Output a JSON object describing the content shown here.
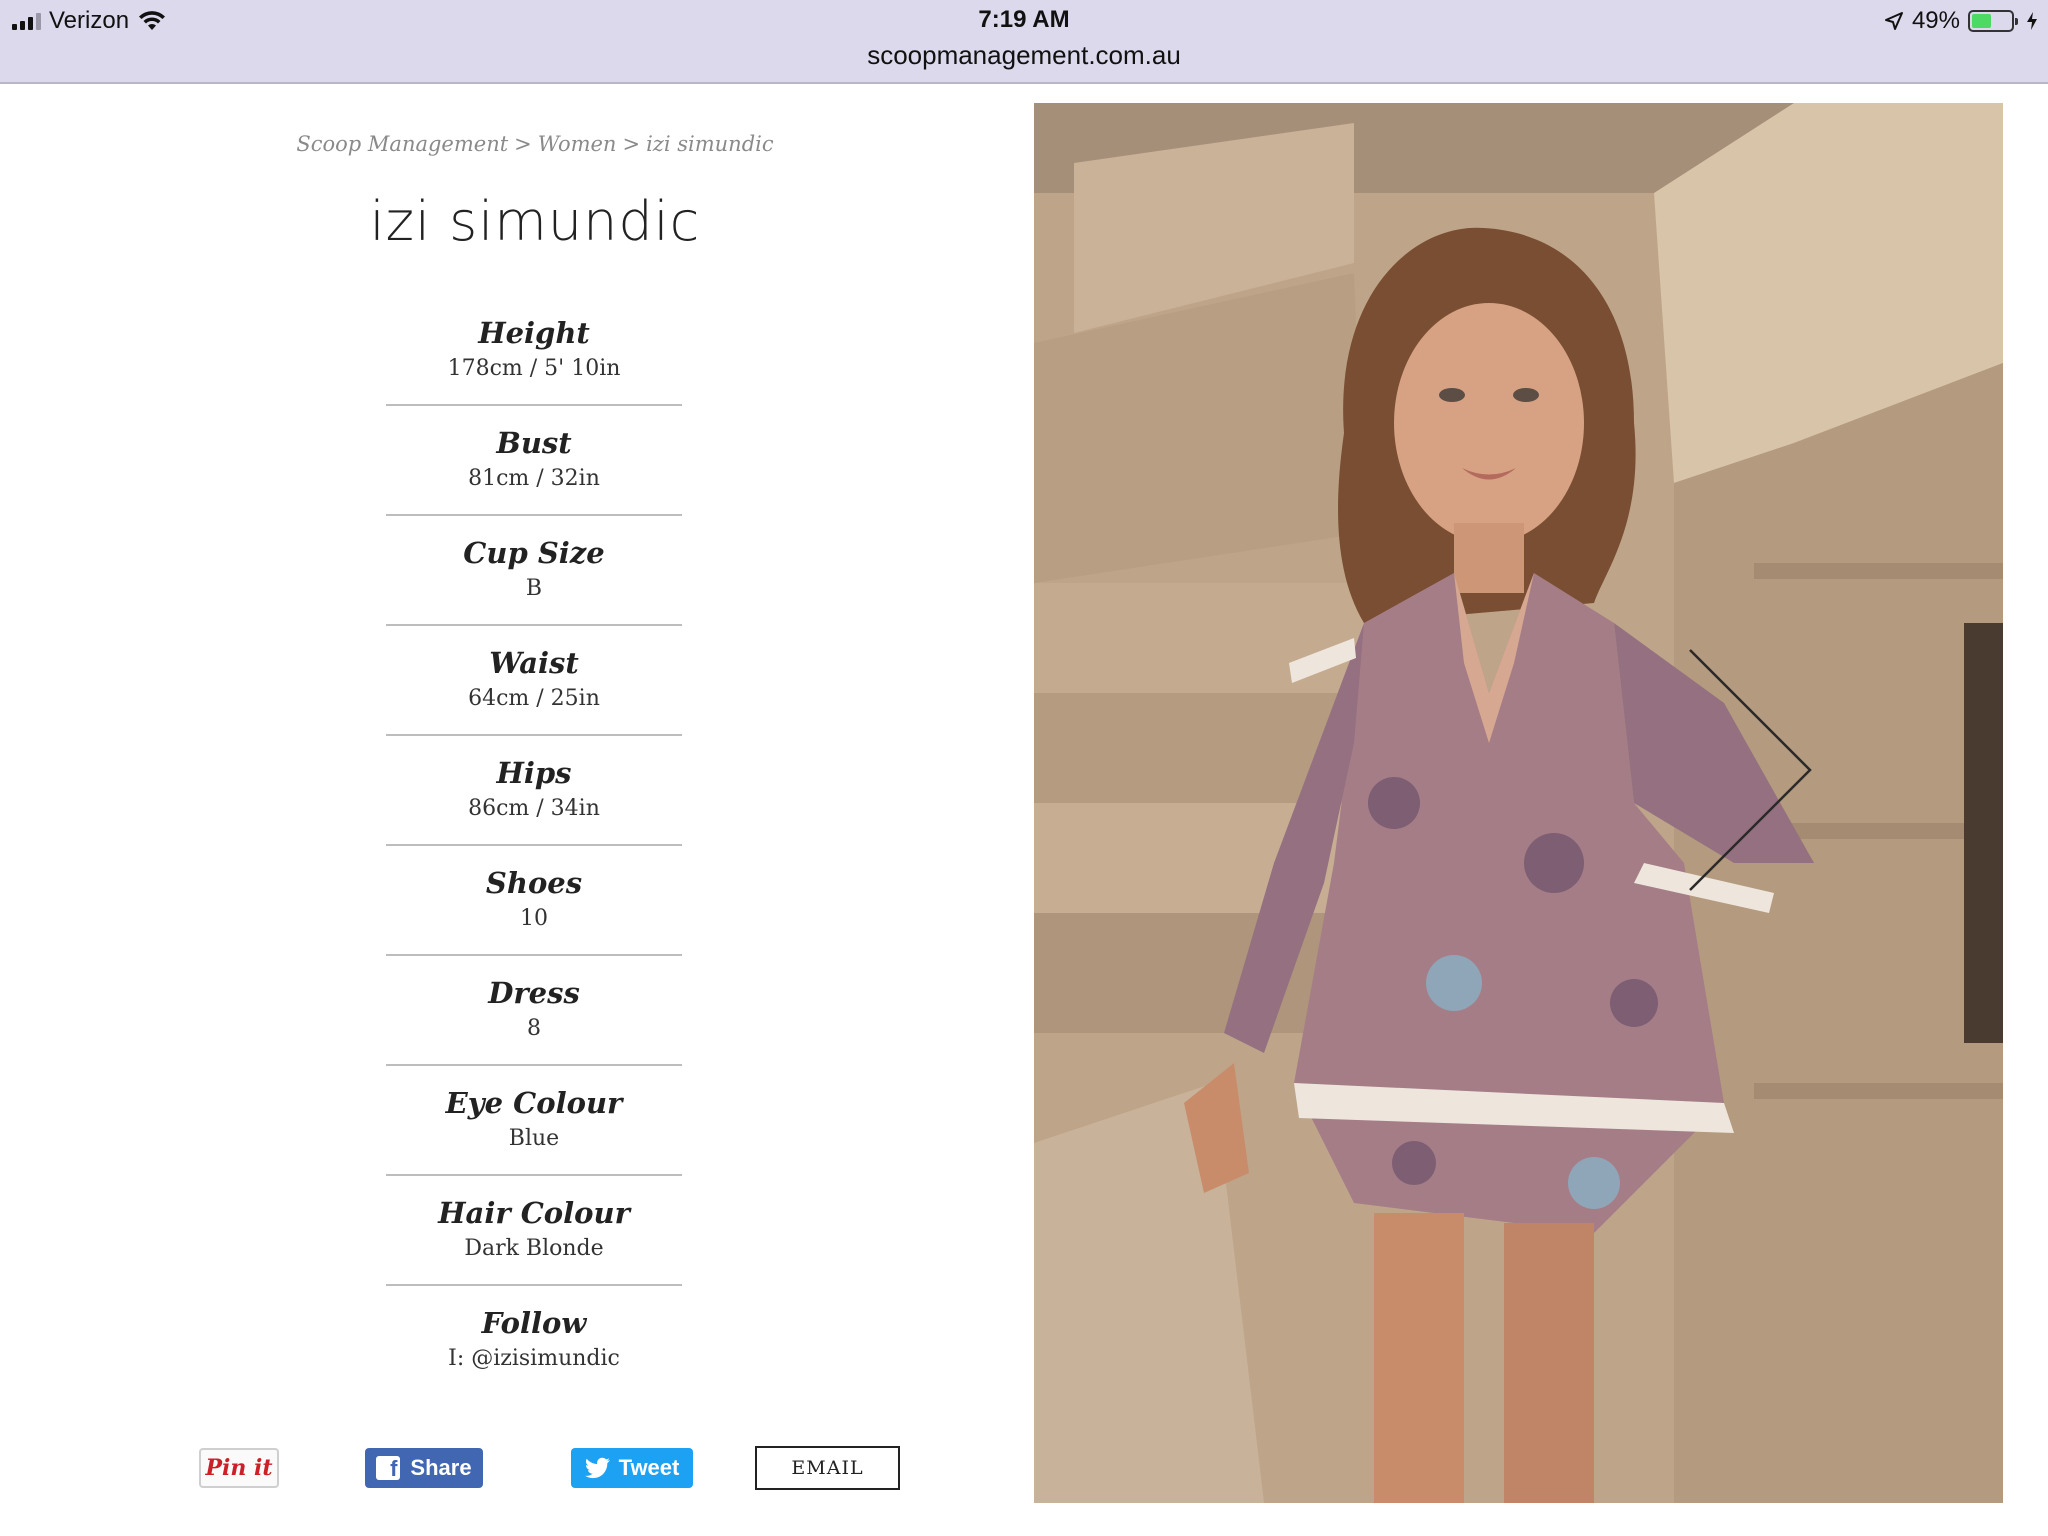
{
  "status_bar": {
    "carrier": "Verizon",
    "time": "7:19 AM",
    "battery_percent": "49%",
    "battery_level": 0.49,
    "icons": [
      "signal-icon",
      "wifi-icon",
      "location-arrow-icon",
      "battery-icon",
      "charging-bolt-icon"
    ]
  },
  "address_bar": {
    "url": "scoopmanagement.com.au"
  },
  "breadcrumb": {
    "items": [
      "Scoop Management",
      "Women",
      "izi simundic"
    ],
    "separator": ">"
  },
  "model": {
    "name": "izi simundic",
    "stats": [
      {
        "label": "Height",
        "value": "178cm / 5' 10in"
      },
      {
        "label": "Bust",
        "value": "81cm / 32in"
      },
      {
        "label": "Cup Size",
        "value": "B"
      },
      {
        "label": "Waist",
        "value": "64cm / 25in"
      },
      {
        "label": "Hips",
        "value": "86cm / 34in"
      },
      {
        "label": "Shoes",
        "value": "10"
      },
      {
        "label": "Dress",
        "value": "8"
      },
      {
        "label": "Eye Colour",
        "value": "Blue"
      },
      {
        "label": "Hair Colour",
        "value": "Dark Blonde"
      },
      {
        "label": "Follow",
        "value": "I: @izisimundic"
      }
    ]
  },
  "share": {
    "pinterest_label": "Pin it",
    "facebook_label": "Share",
    "twitter_label": "Tweet",
    "email_label": "EMAIL"
  },
  "colors": {
    "status_bar_bg": "#dcd9ec",
    "facebook": "#4267b2",
    "twitter": "#1da1f2",
    "pinterest": "#cb2027",
    "battery_fill": "#4cd964"
  }
}
